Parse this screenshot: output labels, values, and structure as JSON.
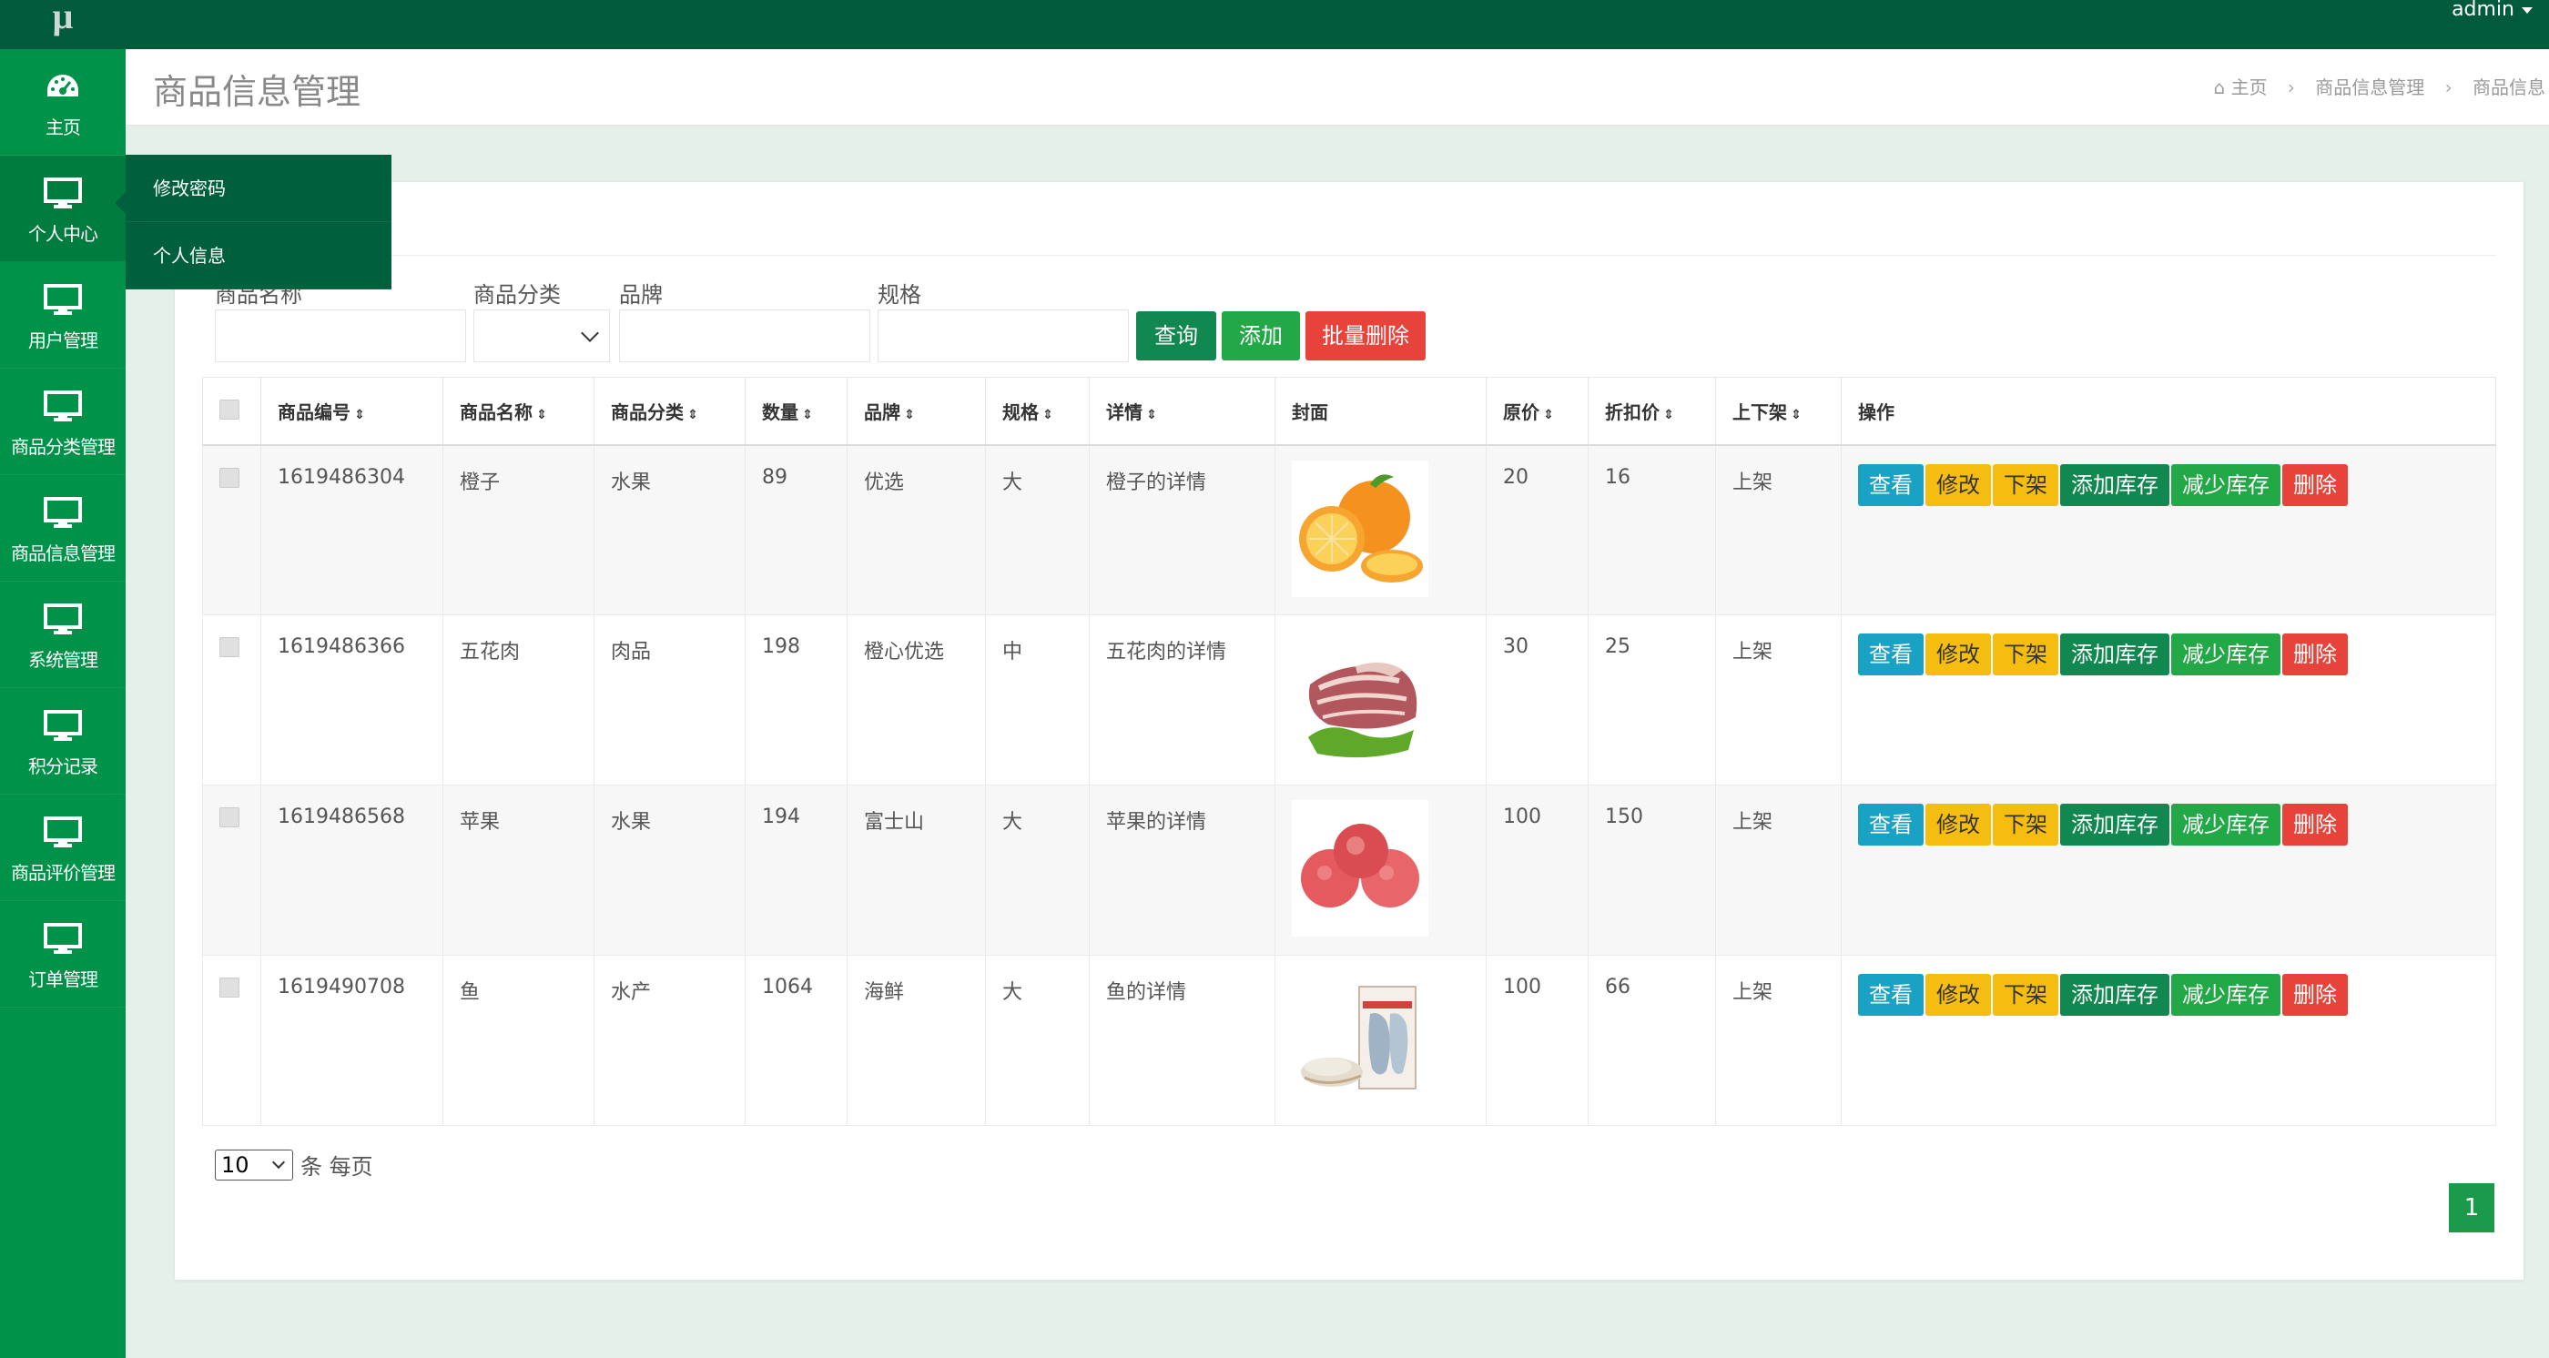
{
  "app": {
    "logo": "μ",
    "user": "admin"
  },
  "sidebar": {
    "items": [
      {
        "label": "主页",
        "icon": "dashboard-icon"
      },
      {
        "label": "个人中心",
        "icon": "monitor-icon"
      },
      {
        "label": "用户管理",
        "icon": "monitor-icon"
      },
      {
        "label": "商品分类管理",
        "icon": "monitor-icon"
      },
      {
        "label": "商品信息管理",
        "icon": "monitor-icon"
      },
      {
        "label": "系统管理",
        "icon": "monitor-icon"
      },
      {
        "label": "积分记录",
        "icon": "monitor-icon"
      },
      {
        "label": "商品评价管理",
        "icon": "monitor-icon"
      },
      {
        "label": "订单管理",
        "icon": "monitor-icon"
      }
    ],
    "submenu": [
      "修改密码",
      "个人信息"
    ]
  },
  "header": {
    "title": "商品信息管理",
    "breadcrumb": [
      "主页",
      "商品信息管理",
      "商品信息"
    ]
  },
  "filters": {
    "name_label": "商品名称",
    "category_label": "商品分类",
    "brand_label": "品牌",
    "spec_label": "规格"
  },
  "buttons": {
    "query": "查询",
    "add": "添加",
    "batch_delete": "批量删除"
  },
  "table": {
    "headers": [
      "商品编号",
      "商品名称",
      "商品分类",
      "数量",
      "品牌",
      "规格",
      "详情",
      "封面",
      "原价",
      "折扣价",
      "上下架",
      "操作"
    ],
    "actions": [
      "查看",
      "修改",
      "下架",
      "添加库存",
      "减少库存",
      "删除"
    ],
    "rows": [
      {
        "id": "1619486304",
        "name": "橙子",
        "category": "水果",
        "qty": "89",
        "brand": "优选",
        "spec": "大",
        "detail": "橙子的详情",
        "price": "20",
        "discount": "16",
        "status": "上架",
        "cover": "orange"
      },
      {
        "id": "1619486366",
        "name": "五花肉",
        "category": "肉品",
        "qty": "198",
        "brand": "橙心优选",
        "spec": "中",
        "detail": "五花肉的详情",
        "price": "30",
        "discount": "25",
        "status": "上架",
        "cover": "pork"
      },
      {
        "id": "1619486568",
        "name": "苹果",
        "category": "水果",
        "qty": "194",
        "brand": "富士山",
        "spec": "大",
        "detail": "苹果的详情",
        "price": "100",
        "discount": "150",
        "status": "上架",
        "cover": "apple"
      },
      {
        "id": "1619490708",
        "name": "鱼",
        "category": "水产",
        "qty": "1064",
        "brand": "海鲜",
        "spec": "大",
        "detail": "鱼的详情",
        "price": "100",
        "discount": "66",
        "status": "上架",
        "cover": "fish"
      }
    ]
  },
  "pagination": {
    "page_size": "10",
    "page_size_suffix": "条 每页",
    "current_page": "1"
  },
  "colors": {
    "topbar": "#005a3c",
    "sidebar": "#009249",
    "primary": "#11884f",
    "danger": "#e8433a",
    "warning": "#f5bd10",
    "info": "#1aa2c4"
  }
}
